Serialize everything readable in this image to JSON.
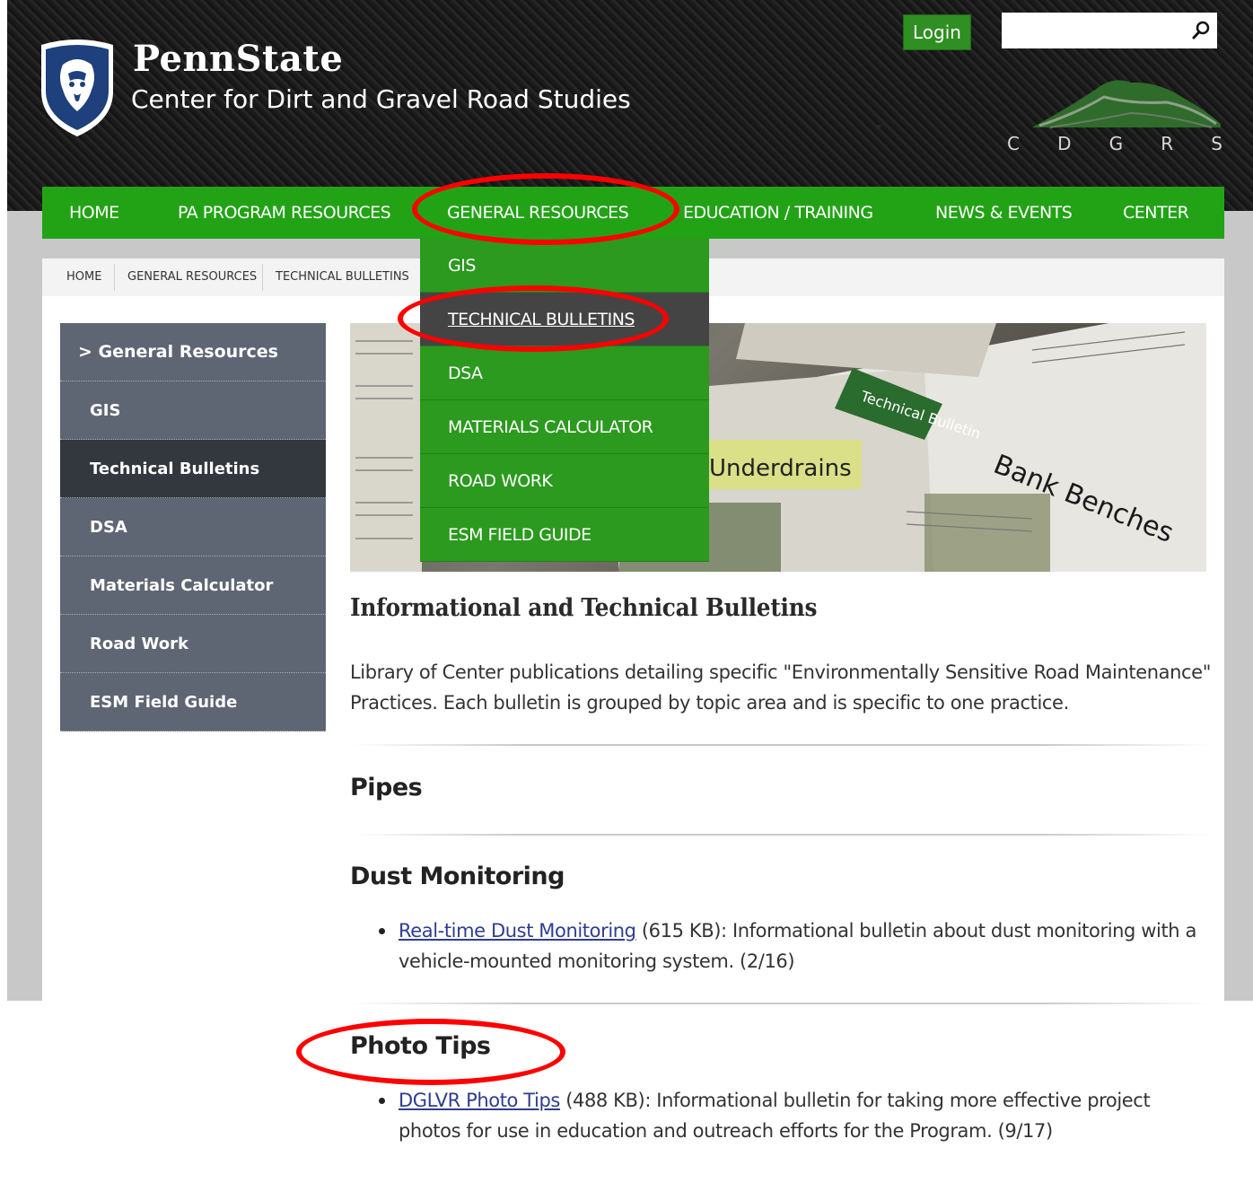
{
  "header": {
    "brand_name": "PennState",
    "brand_subtitle": "Center for Dirt and Gravel Road Studies",
    "login_label": "Login",
    "search_placeholder": "",
    "logo_letters": [
      "C",
      "D",
      "G",
      "R",
      "S"
    ]
  },
  "nav": {
    "items": [
      "HOME",
      "PA PROGRAM RESOURCES",
      "GENERAL RESOURCES",
      "EDUCATION / TRAINING",
      "NEWS & EVENTS",
      "CENTER"
    ]
  },
  "dropdown": {
    "items": [
      "GIS",
      "TECHNICAL BULLETINS",
      "DSA",
      "MATERIALS CALCULATOR",
      "ROAD WORK",
      "ESM FIELD GUIDE"
    ],
    "active": "TECHNICAL BULLETINS"
  },
  "breadcrumb": [
    "HOME",
    "GENERAL RESOURCES",
    "TECHNICAL BULLETINS"
  ],
  "sidebar": {
    "title": "> General Resources",
    "items": [
      "GIS",
      "Technical Bulletins",
      "DSA",
      "Materials Calculator",
      "Road Work",
      "ESM Field Guide"
    ],
    "active": "Technical Bulletins"
  },
  "hero": {
    "texts": [
      "Technical Bulletin",
      "Underdrains",
      "Bank Benches"
    ]
  },
  "main": {
    "heading": "Informational and Technical Bulletins",
    "intro": "Library of Center publications detailing specific \"Environmentally Sensitive Road Maintenance\" Practices. Each bulletin is grouped by topic area and is specific to one practice.",
    "sections": [
      {
        "title": "Pipes"
      },
      {
        "title": "Dust Monitoring",
        "link": "Real-time Dust Monitoring",
        "text": " (615 KB): Informational bulletin about dust monitoring with a vehicle-mounted monitoring system. (2/16)"
      },
      {
        "title": "Photo Tips",
        "link": "DGLVR Photo Tips",
        "text": " (488 KB): Informational bulletin for taking more effective project photos for use in education and outreach efforts for the Program. (9/17)"
      }
    ]
  },
  "colors": {
    "nav_green": "#22a316",
    "dropdown_green": "#2b9a1e",
    "sidebar_gray": "#5e6573",
    "sidebar_active": "#33373e",
    "annotation_red": "#ff0000"
  }
}
